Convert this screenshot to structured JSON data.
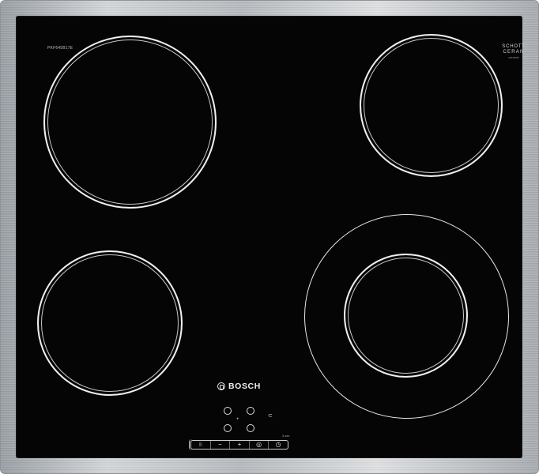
{
  "appliance": {
    "brand": "BOSCH",
    "model_code": "PKF645B17E",
    "glass_logo": [
      "SCHOTT",
      "CERAN",
      "®"
    ],
    "glass_logo_small": "ceramic"
  },
  "controls": {
    "keep_warm_label": "|||",
    "minus_label": "−",
    "plus_label": "+",
    "boost_label": "◎",
    "timer_label": "◷",
    "lock_label": "⊂",
    "tiny_label": "3 sec"
  }
}
